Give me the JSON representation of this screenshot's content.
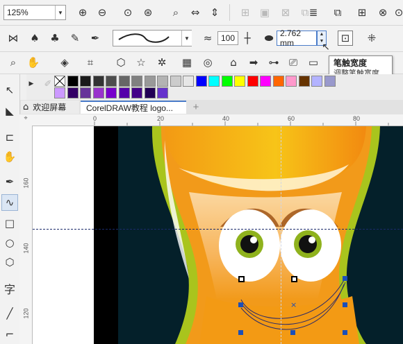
{
  "toolbar_standard": {
    "zoom_value": "125%",
    "icons": [
      "zoom-in-icon",
      "zoom-out-icon",
      "zoom-to-page-icon",
      "zoom-to-selection-icon",
      "pick-page-icon",
      "zoom-width-icon",
      "zoom-height-icon"
    ]
  },
  "property_bar": {
    "smoothing_value": "100",
    "nib_width_value": "2.762 mm"
  },
  "tooltip": {
    "title": "笔触宽度",
    "description": "调整笔触宽度."
  },
  "tabs": {
    "welcome": "欢迎屏幕",
    "document": "CorelDRAW教程 logo...",
    "add": "+"
  },
  "ruler": {
    "top_labels": [
      "0",
      "20",
      "40",
      "60",
      "80"
    ],
    "left_labels": [
      "160",
      "140",
      "120"
    ]
  },
  "palette_row1": [
    "#ffffff",
    "#000000",
    "#1a1a1a",
    "#333333",
    "#4d4d4d",
    "#666666",
    "#808080",
    "#999999",
    "#b3b3b3",
    "#cccccc",
    "#e6e6e6",
    "#0000ff",
    "#00ffff",
    "#00ff00",
    "#ffff00",
    "#ff0000",
    "#ff00ff",
    "#ff6600",
    "#ff99cc",
    "#663300",
    "#b3b3ff",
    "#9999cc"
  ],
  "palette_row2": [
    "#cc99ff",
    "#330066",
    "#663399",
    "#9933cc",
    "#7700cc",
    "#5500aa",
    "#440088",
    "#220055",
    "#6633cc"
  ],
  "colors": {
    "canvas_bg": "#04202a",
    "mascot_outer": "#a9c41d",
    "mascot_orange": "#f29a1a",
    "selection_handle": "#1b4fb8"
  }
}
